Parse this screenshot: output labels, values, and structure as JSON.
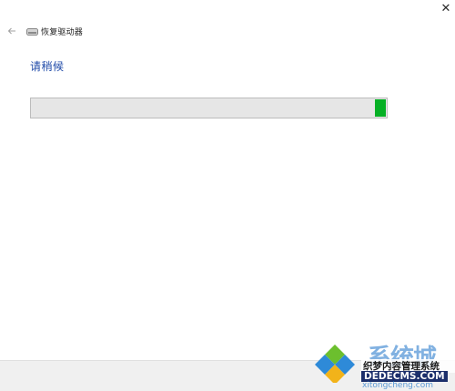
{
  "window": {
    "title": "恢复驱动器",
    "close_glyph": "✕",
    "back_icon": "back-arrow-icon",
    "drive_icon": "drive-icon"
  },
  "main": {
    "heading": "请稍候"
  },
  "progress": {
    "value_fraction": 0.03,
    "track_color": "#e6e6e6",
    "fill_color": "#06b025"
  },
  "watermark": {
    "big_text": "系统城",
    "site_name": "织梦内容管理系统",
    "domain": "DEDECMS.COM",
    "small_text": "xitongcheng.com"
  },
  "colors": {
    "heading": "#1f4aa8",
    "bottom_bar": "#f0f0f0"
  }
}
